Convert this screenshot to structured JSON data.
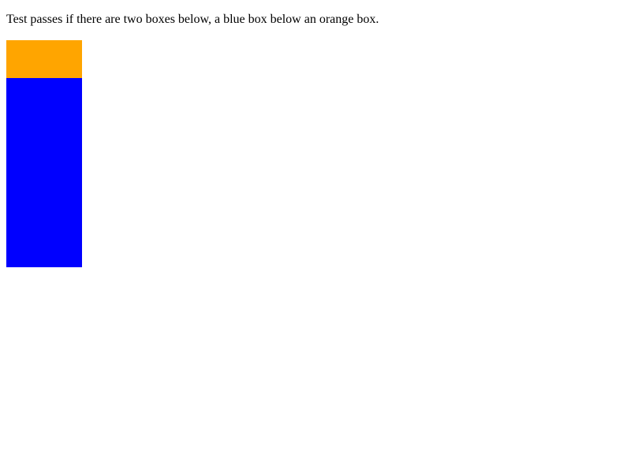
{
  "instruction": {
    "text": "Test passes if there are two boxes below, a blue box below an orange box."
  },
  "boxes": {
    "orange": {
      "color": "#ffa500"
    },
    "blue": {
      "color": "#0000ff"
    }
  }
}
